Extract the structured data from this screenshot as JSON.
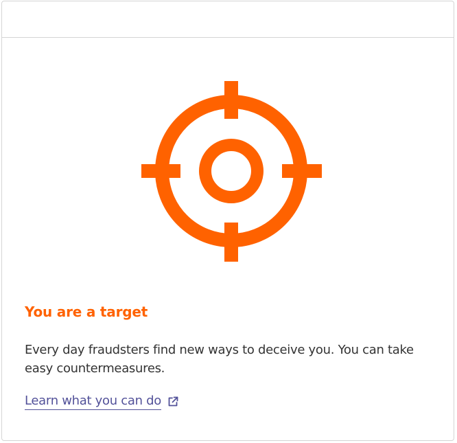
{
  "card": {
    "title": "You are a target",
    "body": "Every day fraudsters find new ways to deceive you. You can take easy countermeasures.",
    "link_label": "Learn what you can do",
    "illustration_icon": "target-crosshair-icon",
    "link_icon": "external-link-icon"
  },
  "colors": {
    "accent": "#ff6200",
    "link": "#525199",
    "text": "#333333",
    "border": "#d4d4d4"
  }
}
